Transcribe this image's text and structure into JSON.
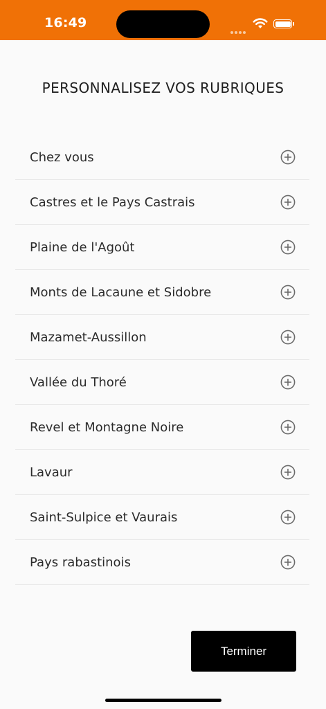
{
  "status_bar": {
    "time": "16:49",
    "icons": [
      "wifi-icon",
      "battery-icon"
    ],
    "background": "#f07106"
  },
  "page": {
    "title": "PERSONNALISEZ VOS RUBRIQUES"
  },
  "rubriques": [
    {
      "label": "Chez vous",
      "icon": "plus-circle-icon"
    },
    {
      "label": "Castres et le Pays Castrais",
      "icon": "plus-circle-icon"
    },
    {
      "label": "Plaine de l'Agoût",
      "icon": "plus-circle-icon"
    },
    {
      "label": "Monts de Lacaune et Sidobre",
      "icon": "plus-circle-icon"
    },
    {
      "label": "Mazamet-Aussillon",
      "icon": "plus-circle-icon"
    },
    {
      "label": "Vallée du Thoré",
      "icon": "plus-circle-icon"
    },
    {
      "label": "Revel et Montagne Noire",
      "icon": "plus-circle-icon"
    },
    {
      "label": "Lavaur",
      "icon": "plus-circle-icon"
    },
    {
      "label": "Saint-Sulpice et Vaurais",
      "icon": "plus-circle-icon"
    },
    {
      "label": "Pays rabastinois",
      "icon": "plus-circle-icon"
    }
  ],
  "actions": {
    "finish_label": "Terminer"
  }
}
